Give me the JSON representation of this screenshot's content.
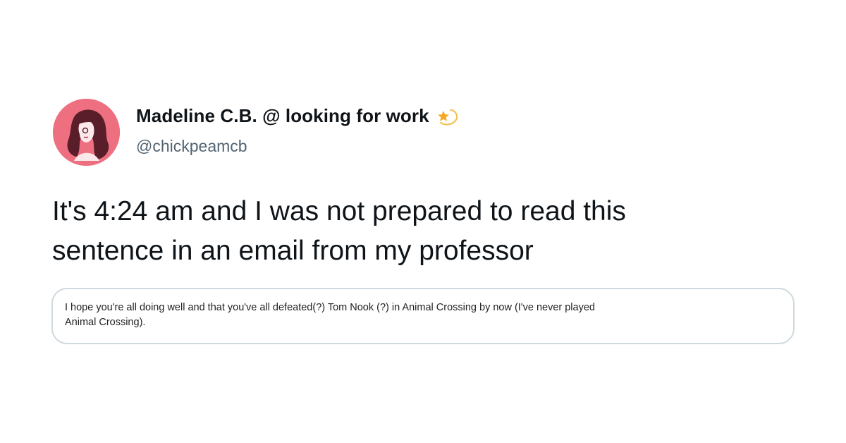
{
  "tweet": {
    "author": {
      "display_name": "Madeline C.B. @ looking for work",
      "handle": "@chickpeamcb",
      "name_emoji_icon": "shooting-star-emoji",
      "avatar_background": "#ee6f80"
    },
    "text_line_1": "It's 4:24 am and I was not prepared to read this",
    "text_line_2": "sentence in an email from my professor",
    "embedded_email": {
      "line_1": "I hope you're all doing well and that you've all defeated(?) Tom Nook (?) in Animal Crossing by now (I've never played",
      "line_2": "Animal Crossing)."
    }
  },
  "colors": {
    "text_primary": "#0f1419",
    "text_secondary": "#536471",
    "border": "#cfd9de"
  }
}
